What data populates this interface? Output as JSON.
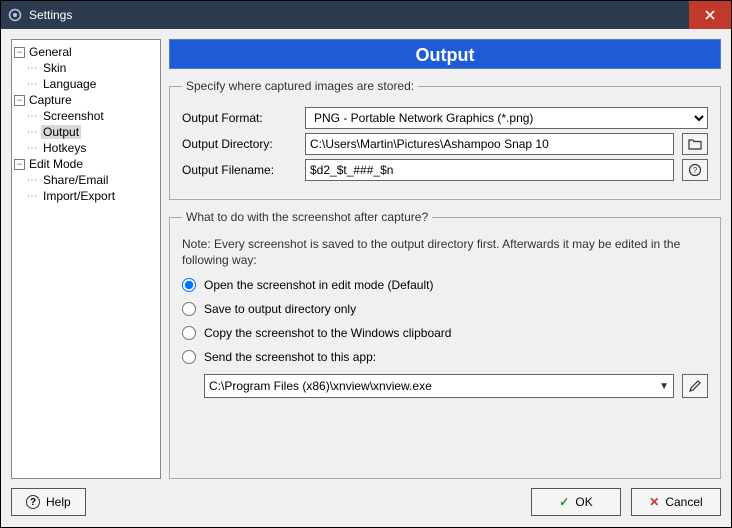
{
  "window": {
    "title": "Settings"
  },
  "tree": {
    "general": {
      "label": "General",
      "skin": "Skin",
      "language": "Language"
    },
    "capture": {
      "label": "Capture",
      "screenshot": "Screenshot",
      "output": "Output",
      "hotkeys": "Hotkeys"
    },
    "editmode": {
      "label": "Edit Mode",
      "shareemail": "Share/Email",
      "importexport": "Import/Export"
    }
  },
  "page": {
    "title": "Output",
    "group1": {
      "legend": "Specify where captured images are stored:",
      "format_label": "Output Format:",
      "format_value": "PNG - Portable Network Graphics (*.png)",
      "dir_label": "Output Directory:",
      "dir_value": "C:\\Users\\Martin\\Pictures\\Ashampoo Snap 10",
      "file_label": "Output Filename:",
      "file_value": "$d2_$t_###_$n"
    },
    "group2": {
      "legend": "What to do with the screenshot after capture?",
      "note": "Note: Every screenshot is saved to the output directory first. Afterwards it may be edited in the following way:",
      "opt_open": "Open the screenshot in edit mode (Default)",
      "opt_save": "Save to output directory only",
      "opt_clip": "Copy the screenshot to the Windows clipboard",
      "opt_app": "Send the screenshot to this app:",
      "app_path": "C:\\Program Files (x86)\\xnview\\xnview.exe"
    }
  },
  "buttons": {
    "help": "Help",
    "ok": "OK",
    "cancel": "Cancel"
  }
}
